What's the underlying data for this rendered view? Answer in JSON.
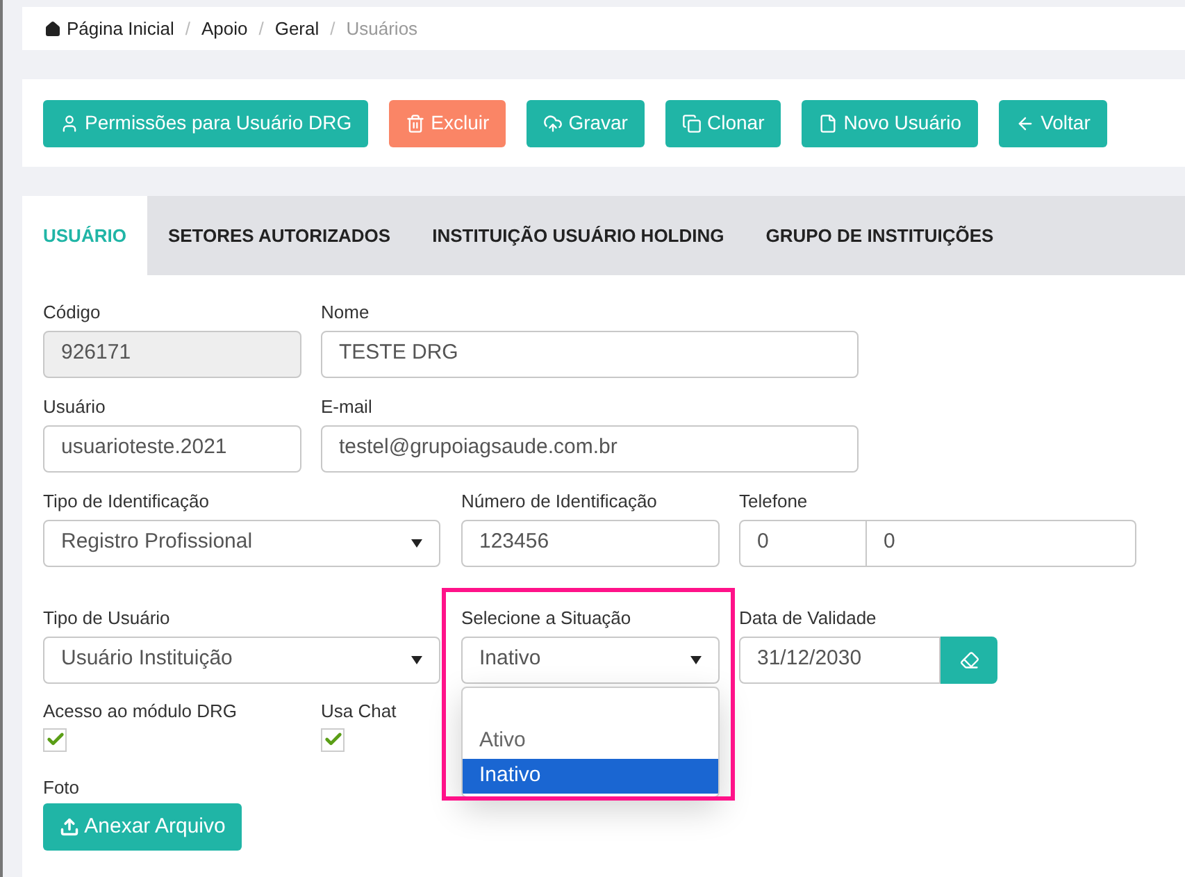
{
  "breadcrumb": [
    {
      "label": "Página Inicial",
      "current": false
    },
    {
      "separator": "/",
      "label": "Apoio",
      "current": false
    },
    {
      "separator": "/",
      "label": "Geral",
      "current": false
    },
    {
      "separator": "/",
      "label": "Usuários",
      "current": true
    }
  ],
  "toolbar": [
    {
      "label": "Permissões para Usuário DRG",
      "kind": "permissions"
    },
    {
      "label": "Excluir",
      "kind": "delete"
    },
    {
      "label": "Gravar",
      "kind": "save"
    },
    {
      "label": "Clonar",
      "kind": "clone"
    },
    {
      "label": "Novo Usuário",
      "kind": "new"
    },
    {
      "label": "Voltar",
      "kind": "back"
    }
  ],
  "tabs": [
    {
      "label": "USUÁRIO",
      "selected": true
    },
    {
      "label": "SETORES AUTORIZADOS",
      "selected": false
    },
    {
      "label": "INSTITUIÇÃO USUÁRIO HOLDING",
      "selected": false
    },
    {
      "label": "GRUPO DE INSTITUIÇÕES",
      "selected": false
    }
  ],
  "rows": [
    [
      {
        "label": "Código",
        "kind": "readonly",
        "value": "926171"
      },
      {
        "label": "Nome",
        "kind": "text",
        "value": "TESTE DRG"
      }
    ],
    [
      {
        "label": "Usuário",
        "kind": "text",
        "value": "usuarioteste.2021"
      },
      {
        "label": "E-mail",
        "kind": "text",
        "value": "testel@grupoiagsaude.com.br"
      }
    ],
    [
      {
        "label": "Tipo de Identificação",
        "kind": "select",
        "value": "Registro Profissional"
      },
      {
        "label": "Número de Identificação",
        "kind": "text",
        "value": "123456"
      },
      {
        "label": "Telefone",
        "kind": "phone",
        "value": "0",
        "value_2": "0"
      }
    ],
    [
      {
        "label": "Tipo de Usuário",
        "kind": "select",
        "value": "Usuário Instituição"
      },
      {
        "label": "Selecione a Situação",
        "kind": "open-select",
        "value": "Inativo",
        "options": [
          {
            "label": "Ativo",
            "selected": false
          },
          {
            "label": "Inativo",
            "selected": true
          }
        ]
      },
      {
        "label": "Data de Validade",
        "kind": "date",
        "value": "31/12/2030"
      }
    ]
  ],
  "checkboxes": [
    {
      "label": "Acesso ao módulo DRG",
      "checked": true
    },
    {
      "label": "Usa Chat",
      "checked": true
    }
  ],
  "photo": {
    "label": "Foto",
    "button": "Anexar Arquivo"
  }
}
